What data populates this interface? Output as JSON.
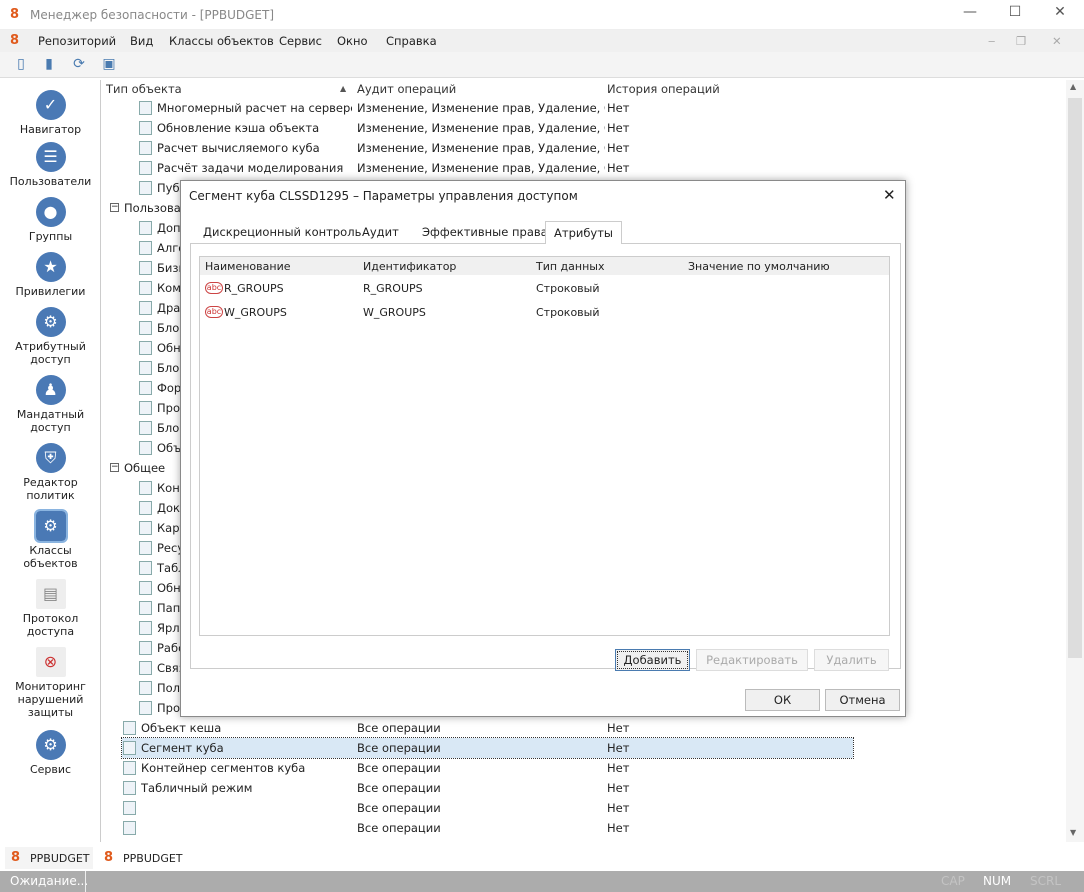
{
  "window": {
    "title": "Менеджер безопасности - [PPBUDGET]",
    "minimize": "—",
    "maximize": "☐",
    "close": "✕"
  },
  "menu": [
    "Репозиторий",
    "Вид",
    "Классы объектов",
    "Сервис",
    "Окно",
    "Справка"
  ],
  "sidebar": [
    {
      "label": "Навигатор",
      "icon": "navigator-icon"
    },
    {
      "label": "Пользователи",
      "icon": "users-icon"
    },
    {
      "label": "Группы",
      "icon": "groups-icon"
    },
    {
      "label": "Привилегии",
      "icon": "privileges-icon"
    },
    {
      "label": "Атрибутный доступ",
      "icon": "attribute-access-icon"
    },
    {
      "label": "Мандатный доступ",
      "icon": "mandatory-access-icon"
    },
    {
      "label": "Редактор политик",
      "icon": "policy-editor-icon"
    },
    {
      "label": "Классы объектов",
      "icon": "object-classes-icon",
      "selected": true
    },
    {
      "label": "Протокол доступа",
      "icon": "access-log-icon"
    },
    {
      "label": "Мониторинг нарушений защиты",
      "icon": "monitoring-icon"
    },
    {
      "label": "Сервис",
      "icon": "service-icon"
    }
  ],
  "grid": {
    "headers": [
      "Тип объекта",
      "Аудит операций",
      "История операций"
    ],
    "rows": [
      {
        "name": "Многомерный расчет на сервере ...",
        "audit": "Изменение, Изменение прав, Удаление, Соз...",
        "history": "Нет",
        "level": 2
      },
      {
        "name": "Обновление кэша объекта",
        "audit": "Изменение, Изменение прав, Удаление, Соз...",
        "history": "Нет",
        "level": 2
      },
      {
        "name": "Расчет вычисляемого куба",
        "audit": "Изменение, Изменение прав, Удаление, Соз...",
        "history": "Нет",
        "level": 2
      },
      {
        "name": "Расчёт задачи моделирования",
        "audit": "Изменение, Изменение прав, Удаление, Соз...",
        "history": "Нет",
        "level": 2
      },
      {
        "name": "Публ",
        "level": 2
      },
      {
        "name": "Пользоват",
        "level": 0,
        "group": true
      },
      {
        "name": "Доп",
        "level": 2
      },
      {
        "name": "Алго",
        "level": 2
      },
      {
        "name": "Бизн",
        "level": 2
      },
      {
        "name": "Ком",
        "level": 2
      },
      {
        "name": "Дра",
        "level": 2
      },
      {
        "name": "Блок",
        "level": 2
      },
      {
        "name": "Обн",
        "level": 2
      },
      {
        "name": "Блок",
        "level": 2
      },
      {
        "name": "Фор",
        "level": 2
      },
      {
        "name": "Про",
        "level": 2
      },
      {
        "name": "Блок",
        "level": 2
      },
      {
        "name": "Объ",
        "level": 2
      },
      {
        "name": "Общее",
        "level": 0,
        "group": true
      },
      {
        "name": "Конт",
        "level": 2
      },
      {
        "name": "Доку",
        "level": 2
      },
      {
        "name": "Карт",
        "level": 2
      },
      {
        "name": "Ресу",
        "level": 2
      },
      {
        "name": "Табл",
        "level": 2
      },
      {
        "name": "Обн",
        "level": 2
      },
      {
        "name": "Папк",
        "level": 2
      },
      {
        "name": "Ярлы",
        "level": 2
      },
      {
        "name": "Рабо",
        "level": 2
      },
      {
        "name": "Связ",
        "level": 2
      },
      {
        "name": "Пол",
        "level": 2
      },
      {
        "name": "Про",
        "level": 2
      },
      {
        "name": "Объект кеша",
        "audit": "Все операции",
        "history": "Нет",
        "level": 1
      },
      {
        "name": "Сегмент куба",
        "audit": "Все операции",
        "history": "Нет",
        "level": 1,
        "selected": true
      },
      {
        "name": "Контейнер сегментов куба",
        "audit": "Все операции",
        "history": "Нет",
        "level": 1
      },
      {
        "name": "Табличный режим",
        "audit": "Все операции",
        "history": "Нет",
        "level": 1
      },
      {
        "name": "",
        "audit": "Все операции",
        "history": "Нет",
        "level": 1
      },
      {
        "name": "",
        "audit": "Все операции",
        "history": "Нет",
        "level": 1
      }
    ]
  },
  "dialog": {
    "title": "Сегмент куба CLSSD1295 – Параметры управления доступом",
    "tabs": [
      "Дискреционный контроль",
      "Аудит",
      "Эффективные права",
      "Атрибуты"
    ],
    "active_tab": 3,
    "headers": [
      "Наименование",
      "Идентификатор",
      "Тип данных",
      "Значение по умолчанию"
    ],
    "rows": [
      {
        "name": "R_GROUPS",
        "id": "R_GROUPS",
        "type": "Строковый",
        "default": ""
      },
      {
        "name": "W_GROUPS",
        "id": "W_GROUPS",
        "type": "Строковый",
        "default": ""
      }
    ],
    "add": "Добавить",
    "edit": "Редактировать",
    "delete": "Удалить",
    "ok": "ОК",
    "cancel": "Отмена",
    "icon_text": "abc"
  },
  "doc_tabs": [
    "PPBUDGET",
    "PPBUDGET"
  ],
  "status": {
    "text": "Ожидание...",
    "cap": "CAP",
    "num": "NUM",
    "scrl": "SCRL"
  }
}
